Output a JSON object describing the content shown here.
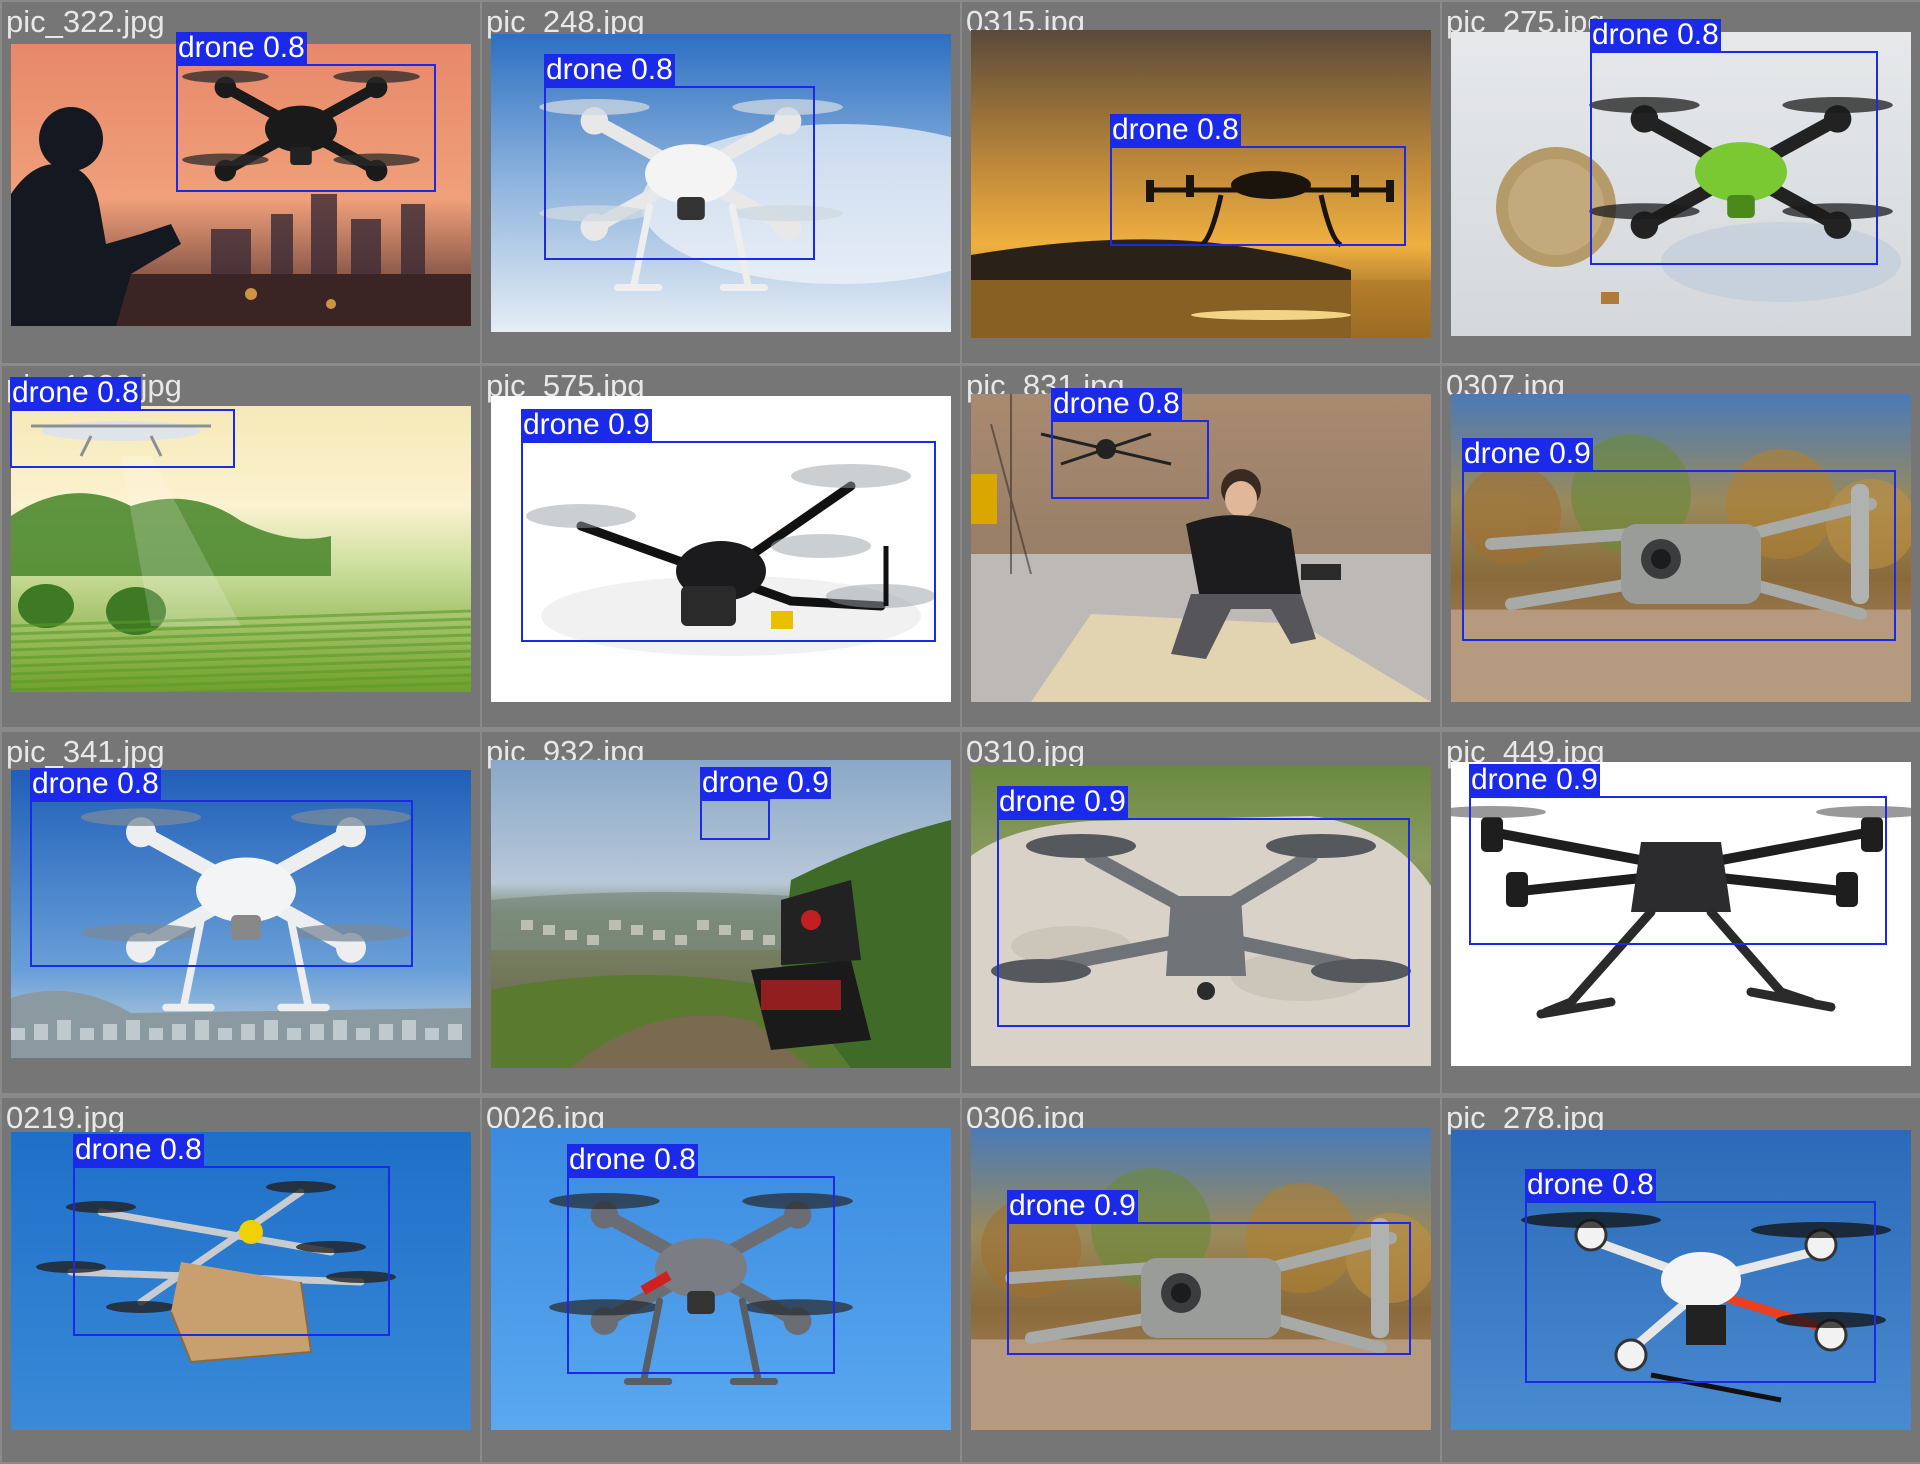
{
  "tiles": [
    {
      "filename": "pic_322.jpg",
      "scene": "sunset-city",
      "detection": {
        "label": "drone 0.8",
        "class": "drone",
        "confidence": 0.8
      }
    },
    {
      "filename": "pic_248.jpg",
      "scene": "blue-sky-white-quad",
      "detection": {
        "label": "drone 0.8",
        "class": "drone",
        "confidence": 0.8
      }
    },
    {
      "filename": "0315.jpg",
      "scene": "golden-sunset-hexacopter",
      "detection": {
        "label": "drone 0.8",
        "class": "drone",
        "confidence": 0.8
      }
    },
    {
      "filename": "pic_275.jpg",
      "scene": "green-mini-drone-coin",
      "detection": {
        "label": "drone 0.8",
        "class": "drone",
        "confidence": 0.8
      }
    },
    {
      "filename": "pic_1382.jpg",
      "scene": "green-field",
      "detection": {
        "label": "drone 0.8",
        "class": "drone",
        "confidence": 0.8
      }
    },
    {
      "filename": "pic_575.jpg",
      "scene": "white-bg-black-quad",
      "detection": {
        "label": "drone 0.9",
        "class": "drone",
        "confidence": 0.9
      }
    },
    {
      "filename": "pic_831.jpg",
      "scene": "studio-person-drone",
      "detection": {
        "label": "drone 0.8",
        "class": "drone",
        "confidence": 0.8
      }
    },
    {
      "filename": "0307.jpg",
      "scene": "autumn-grey-quad",
      "detection": {
        "label": "drone 0.9",
        "class": "drone",
        "confidence": 0.9
      }
    },
    {
      "filename": "pic_341.jpg",
      "scene": "sky-white-quad-city",
      "detection": {
        "label": "drone 0.8",
        "class": "drone",
        "confidence": 0.8
      }
    },
    {
      "filename": "pic_932.jpg",
      "scene": "hillside-case",
      "detection": {
        "label": "drone 0.9",
        "class": "drone",
        "confidence": 0.9
      }
    },
    {
      "filename": "0310.jpg",
      "scene": "rock-grey-foldable",
      "detection": {
        "label": "drone 0.9",
        "class": "drone",
        "confidence": 0.9
      }
    },
    {
      "filename": "pic_449.jpg",
      "scene": "white-bg-industrial",
      "detection": {
        "label": "drone 0.9",
        "class": "drone",
        "confidence": 0.9
      }
    },
    {
      "filename": "0219.jpg",
      "scene": "blue-sky-delivery",
      "detection": {
        "label": "drone 0.8",
        "class": "drone",
        "confidence": 0.8
      }
    },
    {
      "filename": "0026.jpg",
      "scene": "blue-sky-grey-quad",
      "detection": {
        "label": "drone 0.8",
        "class": "drone",
        "confidence": 0.8
      }
    },
    {
      "filename": "0306.jpg",
      "scene": "autumn-grey-quad-low",
      "detection": {
        "label": "drone 0.9",
        "class": "drone",
        "confidence": 0.9
      }
    },
    {
      "filename": "pic_278.jpg",
      "scene": "blue-sky-white-red-quad",
      "detection": {
        "label": "drone 0.8",
        "class": "drone",
        "confidence": 0.8
      }
    }
  ],
  "colors": {
    "box": "#1a2ae8",
    "label_text": "#ffffff",
    "filename_text": "#e8e8e8",
    "tile_background": "#767676"
  }
}
